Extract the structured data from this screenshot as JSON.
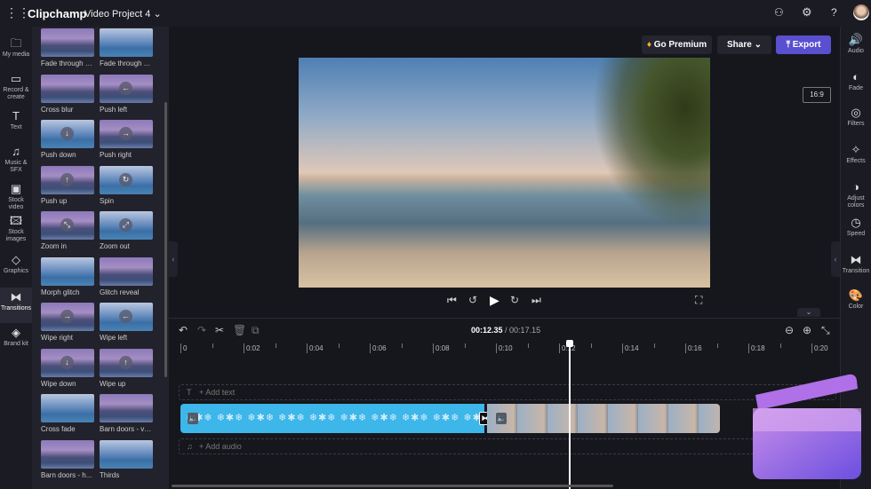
{
  "app": {
    "title": "Clipchamp",
    "project": "Video Project 4"
  },
  "icons": {
    "apps": "grid-icon",
    "chevron": "chevron-down-icon",
    "accent": "#5a4fcf",
    "clip_color": "#3db6ea"
  },
  "rail": [
    {
      "label": "My media",
      "icon": "🗀"
    },
    {
      "label": "Record & create",
      "icon": "▭"
    },
    {
      "label": "Text",
      "icon": "T"
    },
    {
      "label": "Music & SFX",
      "icon": "♫"
    },
    {
      "label": "Stock video",
      "icon": "▣"
    },
    {
      "label": "Stock images",
      "icon": "🖾"
    },
    {
      "label": "Graphics",
      "icon": "◇"
    },
    {
      "label": "Transitions",
      "icon": "⧓"
    },
    {
      "label": "Brand kit",
      "icon": "◈"
    }
  ],
  "transitions": [
    "Fade through b...",
    "Fade through ...",
    "Cross blur",
    "Push left",
    "Push down",
    "Push right",
    "Push up",
    "Spin",
    "Zoom in",
    "Zoom out",
    "Morph glitch",
    "Glitch reveal",
    "Wipe right",
    "Wipe left",
    "Wipe down",
    "Wipe up",
    "Cross fade",
    "Barn doors - ve...",
    "Barn doors - h...",
    "Thirds"
  ],
  "header": {
    "premium": "Go Premium",
    "share": "Share",
    "export": "Export",
    "aspect": "16:9"
  },
  "right_rail": [
    "Audio",
    "Fade",
    "Filters",
    "Effects",
    "Adjust colors",
    "Speed",
    "Transition",
    "Color"
  ],
  "timeline": {
    "current": "00:12.35",
    "total": "/ 00:17.15",
    "current_seconds": 12.35,
    "ticks": [
      "0",
      "0:02",
      "0:04",
      "0:06",
      "0:08",
      "0:10",
      "0:12",
      "0:14",
      "0:16",
      "0:18",
      "0:20"
    ],
    "add_text": "+ Add text",
    "add_audio": "+ Add audio"
  }
}
